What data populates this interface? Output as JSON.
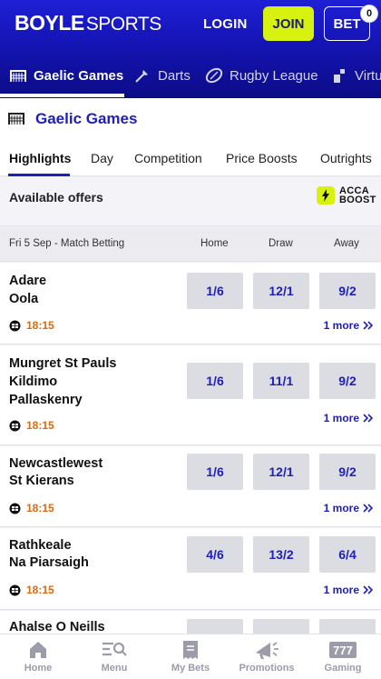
{
  "header": {
    "logo_bold": "BOYLE",
    "logo_light": "SPORTS",
    "login_label": "LOGIN",
    "join_label": "JOIN",
    "bet_label": "BET",
    "bet_count": "0"
  },
  "sport_nav": [
    {
      "label": "Gaelic Games",
      "icon": "gaelic-goal-icon",
      "active": true
    },
    {
      "label": "Darts",
      "icon": "dart-icon",
      "active": false
    },
    {
      "label": "Rugby League",
      "icon": "rugby-ball-icon",
      "active": false
    },
    {
      "label": "Virtu",
      "icon": "virtual-icon",
      "active": false
    }
  ],
  "page": {
    "title": "Gaelic Games",
    "tabs": [
      "Highlights",
      "Day",
      "Competition",
      "Price Boosts",
      "Outrights"
    ],
    "active_tab": "Highlights"
  },
  "offers": {
    "label": "Available offers",
    "acca_line1": "ACCA",
    "acca_line2": "BOOST"
  },
  "market": {
    "heading": "Fri 5 Sep - Match Betting",
    "col_home": "Home",
    "col_draw": "Draw",
    "col_away": "Away"
  },
  "matches": [
    {
      "teams": [
        "Adare",
        "Oola"
      ],
      "time": "18:15",
      "home": "1/6",
      "draw": "12/1",
      "away": "9/2",
      "more": "1 more"
    },
    {
      "teams": [
        "Mungret St Pauls",
        "Kildimo",
        "Pallaskenry"
      ],
      "time": "18:15",
      "home": "1/6",
      "draw": "11/1",
      "away": "9/2",
      "more": "1 more"
    },
    {
      "teams": [
        "Newcastlewest",
        "St Kierans"
      ],
      "time": "18:15",
      "home": "1/6",
      "draw": "12/1",
      "away": "9/2",
      "more": "1 more"
    },
    {
      "teams": [
        "Rathkeale",
        "Na Piarsaigh"
      ],
      "time": "18:15",
      "home": "4/6",
      "draw": "13/2",
      "away": "6/4",
      "more": "1 more"
    }
  ],
  "partial_match": {
    "team": "Ahalse O Neills"
  },
  "bottom_nav": [
    {
      "label": "Home",
      "icon": "home-icon"
    },
    {
      "label": "Menu",
      "icon": "menu-search-icon"
    },
    {
      "label": "My Bets",
      "icon": "betslip-icon"
    },
    {
      "label": "Promotions",
      "icon": "megaphone-icon"
    },
    {
      "label": "Gaming",
      "icon": "slot-777-icon"
    }
  ],
  "colors": {
    "brand_blue": "#1f1fd6",
    "accent_lime": "#d8f20f",
    "time_orange": "#d86a10",
    "odds_text": "#2020b8"
  }
}
